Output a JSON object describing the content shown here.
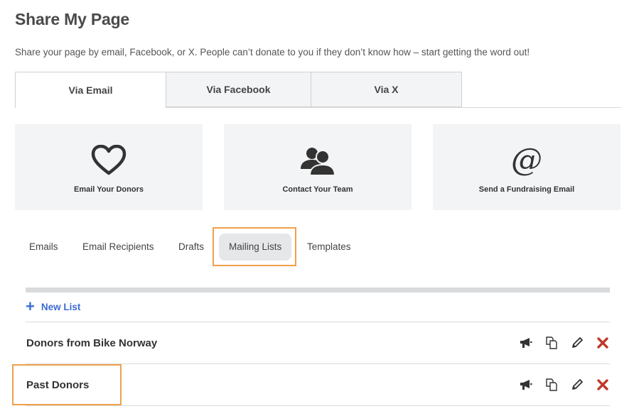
{
  "page": {
    "title": "Share My Page",
    "subtitle": "Share your page by email, Facebook, or X. People can’t donate to you if they don’t know how – start getting the word out!"
  },
  "tabs": [
    {
      "label": "Via Email",
      "active": true
    },
    {
      "label": "Via Facebook",
      "active": false
    },
    {
      "label": "Via X",
      "active": false
    }
  ],
  "cards": [
    {
      "label": "Email Your Donors",
      "icon": "heart-icon"
    },
    {
      "label": "Contact Your Team",
      "icon": "team-icon"
    },
    {
      "label": "Send a Fundraising Email",
      "icon": "at-sign-icon",
      "glyph": "@"
    }
  ],
  "subtabs": [
    {
      "label": "Emails"
    },
    {
      "label": "Email Recipients"
    },
    {
      "label": "Drafts"
    },
    {
      "label": "Mailing Lists",
      "active": true
    },
    {
      "label": "Templates"
    }
  ],
  "new_list": {
    "label": "New List",
    "glyph": "+"
  },
  "mailing_lists": [
    {
      "name": "Donors from Bike Norway"
    },
    {
      "name": "Past Donors"
    }
  ],
  "colors": {
    "accent": "#3b6ccf",
    "highlight": "#f0a04b",
    "delete": "#c0392b",
    "card_bg": "#f3f4f5"
  }
}
